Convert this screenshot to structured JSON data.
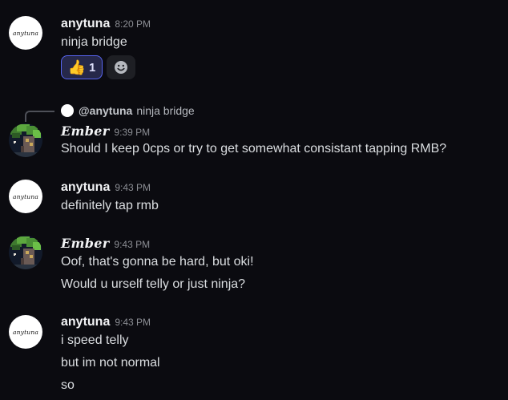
{
  "messages": [
    {
      "user": "anytuna",
      "avatar_text": "anytuna",
      "time": "8:20 PM",
      "lines": [
        "ninja bridge"
      ],
      "reactions": [
        {
          "emoji": "👍",
          "count": "1",
          "icon": "thumbs-up-icon"
        },
        {
          "icon": "add-reaction-icon"
        }
      ]
    },
    {
      "reply": {
        "user": "@anytuna",
        "text": "ninja bridge"
      },
      "user": "Ember",
      "time": "9:39 PM",
      "lines": [
        "Should I keep 0cps or try to get somewhat consistant tapping RMB?"
      ]
    },
    {
      "user": "anytuna",
      "avatar_text": "anytuna",
      "time": "9:43 PM",
      "lines": [
        "definitely tap rmb"
      ]
    },
    {
      "user": "Ember",
      "time": "9:43 PM",
      "lines": [
        "Oof, that's gonna be hard, but oki!",
        "Would u urself telly or just ninja?"
      ]
    },
    {
      "user": "anytuna",
      "avatar_text": "anytuna",
      "time": "9:43 PM",
      "lines": [
        "i speed telly",
        "but im not normal",
        "so"
      ]
    }
  ],
  "colors": {
    "background": "#0b0b10",
    "reaction_active_bg": "#26284a",
    "reaction_active_border": "#5865f2"
  }
}
